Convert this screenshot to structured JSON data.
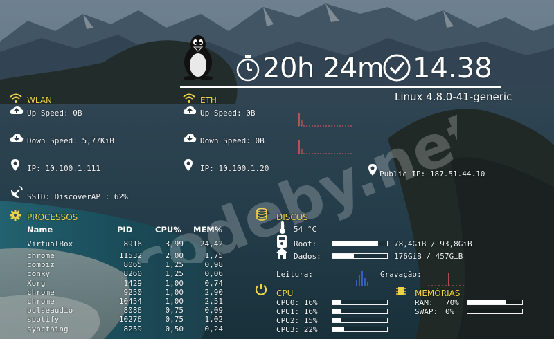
{
  "clock": {
    "uptime": "20h 24m",
    "time": "14.38",
    "kernel": "Linux 4.8.0-41-generic"
  },
  "wlan": {
    "title": "WLAN",
    "up_label": "Up Speed: 0B",
    "down_label": "Down Speed: 5,77KiB",
    "ip_label": "IP: 10.100.1.111",
    "ssid_label": "SSID: DiscoverAP : 62%"
  },
  "eth": {
    "title": "ETH",
    "up_label": "Up Speed: 0B",
    "down_label": "Down Speed: 0B",
    "ip_label": "IP: 10.100.1.20"
  },
  "public_ip_label": "Public IP: 187.51.44.10",
  "processes": {
    "title": "PROCESSOS",
    "columns": [
      "Name",
      "PID",
      "CPU%",
      "MEM%"
    ],
    "rows": [
      {
        "name": "VirtualBox",
        "pid": "8916",
        "cpu": "3,99",
        "mem": "24,42"
      },
      {
        "name": "chrome",
        "pid": "11532",
        "cpu": "2,00",
        "mem": "1,75"
      },
      {
        "name": "compiz",
        "pid": "8065",
        "cpu": "1,25",
        "mem": "0,98"
      },
      {
        "name": "conky",
        "pid": "8260",
        "cpu": "1,25",
        "mem": "0,06"
      },
      {
        "name": "Xorg",
        "pid": "1429",
        "cpu": "1,00",
        "mem": "0,74"
      },
      {
        "name": "chrome",
        "pid": "9250",
        "cpu": "1,00",
        "mem": "2,90"
      },
      {
        "name": "chrome",
        "pid": "10454",
        "cpu": "1,00",
        "mem": "2,51"
      },
      {
        "name": "pulseaudio",
        "pid": "8086",
        "cpu": "0,75",
        "mem": "0,09"
      },
      {
        "name": "spotify",
        "pid": "10276",
        "cpu": "0,75",
        "mem": "1,02"
      },
      {
        "name": "syncthing",
        "pid": "8259",
        "cpu": "0,50",
        "mem": "0,24"
      }
    ]
  },
  "disks": {
    "title": "DISCOS",
    "temp": "54 °C",
    "root_label": "Root:",
    "root_value": "78,4GiB / 93,8GiB",
    "root_fraction": 0.84,
    "data_label": "Dados:",
    "data_value": "176GiB / 457GiB",
    "data_fraction": 0.39,
    "read_label": "Leitura:",
    "write_label": "Gravação:"
  },
  "cpu": {
    "title": "CPU",
    "cores": [
      {
        "label": "CPU0: 16%",
        "fraction": 0.16
      },
      {
        "label": "CPU1: 16%",
        "fraction": 0.16
      },
      {
        "label": "CPU2: 15%",
        "fraction": 0.15
      },
      {
        "label": "CPU3: 22%",
        "fraction": 0.22
      }
    ]
  },
  "memory": {
    "title": "MEMÓRIAS",
    "ram_label": "RAM:",
    "ram_pct": "70%",
    "ram_fraction": 0.7,
    "swap_label": "SWAP:",
    "swap_pct": "0%",
    "swap_fraction": 0.0
  },
  "watermark": "codeby.net",
  "icons": [
    "tux-icon",
    "stopwatch-icon",
    "clock-check-icon",
    "wifi-icon",
    "ethernet-icon",
    "upload-cloud-icon",
    "download-cloud-icon",
    "location-pin-icon",
    "satellite-dish-icon",
    "gear-icon",
    "database-icon",
    "thermometer-icon",
    "hard-drive-icon",
    "home-icon",
    "power-icon",
    "memory-chip-icon"
  ],
  "colors": {
    "accent": "#f0d24a",
    "text": "#f2f4f6",
    "graph_red": "#e05a5a",
    "graph_blue": "#3c6cf0"
  }
}
